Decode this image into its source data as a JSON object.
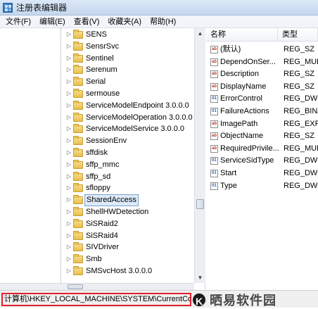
{
  "window": {
    "title": "注册表编辑器"
  },
  "menu": [
    "文件(F)",
    "编辑(E)",
    "查看(V)",
    "收藏夹(A)",
    "帮助(H)"
  ],
  "tree": {
    "items": [
      {
        "label": "SENS"
      },
      {
        "label": "SensrSvc"
      },
      {
        "label": "Sentinel"
      },
      {
        "label": "Serenum"
      },
      {
        "label": "Serial"
      },
      {
        "label": "sermouse"
      },
      {
        "label": "ServiceModelEndpoint 3.0.0.0"
      },
      {
        "label": "ServiceModelOperation 3.0.0.0"
      },
      {
        "label": "ServiceModelService 3.0.0.0"
      },
      {
        "label": "SessionEnv"
      },
      {
        "label": "sffdisk"
      },
      {
        "label": "sffp_mmc"
      },
      {
        "label": "sffp_sd"
      },
      {
        "label": "sfloppy"
      },
      {
        "label": "SharedAccess",
        "selected": true
      },
      {
        "label": "ShellHWDetection"
      },
      {
        "label": "SiSRaid2"
      },
      {
        "label": "SiSRaid4"
      },
      {
        "label": "SIVDriver"
      },
      {
        "label": "Smb"
      },
      {
        "label": "SMSvcHost 3.0.0.0"
      }
    ]
  },
  "values_pane": {
    "columns": {
      "name": "名称",
      "type": "类型"
    },
    "rows": [
      {
        "name": "(默认)",
        "type": "REG_SZ",
        "icon": "string-value-icon"
      },
      {
        "name": "DependOnSer...",
        "type": "REG_MULT",
        "icon": "string-value-icon"
      },
      {
        "name": "Description",
        "type": "REG_SZ",
        "icon": "string-value-icon"
      },
      {
        "name": "DisplayName",
        "type": "REG_SZ",
        "icon": "string-value-icon"
      },
      {
        "name": "ErrorControl",
        "type": "REG_DWO",
        "icon": "binary-value-icon"
      },
      {
        "name": "FailureActions",
        "type": "REG_BINA",
        "icon": "binary-value-icon"
      },
      {
        "name": "ImagePath",
        "type": "REG_EXPA",
        "icon": "string-value-icon"
      },
      {
        "name": "ObjectName",
        "type": "REG_SZ",
        "icon": "string-value-icon"
      },
      {
        "name": "RequiredPrivile...",
        "type": "REG_MULT",
        "icon": "string-value-icon"
      },
      {
        "name": "ServiceSidType",
        "type": "REG_DWO",
        "icon": "binary-value-icon"
      },
      {
        "name": "Start",
        "type": "REG_DWO",
        "icon": "binary-value-icon"
      },
      {
        "name": "Type",
        "type": "REG_DWO",
        "icon": "binary-value-icon"
      }
    ]
  },
  "statusbar": {
    "path": "计算机\\HKEY_LOCAL_MACHINE\\SYSTEM\\CurrentControlSet\\services\\SharedAccess",
    "watermark_logo": "K",
    "watermark_text": "晒易软件园"
  },
  "colors": {
    "highlight_border": "#e0202a",
    "selection": "#dceaf9"
  }
}
